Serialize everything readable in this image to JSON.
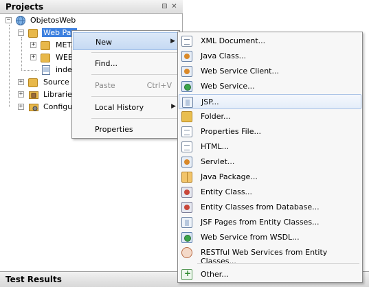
{
  "projects_panel": {
    "title": "Projects",
    "minimize_glyph": "⊟",
    "close_glyph": "✕",
    "tree": [
      {
        "label": "ObjetosWeb",
        "icon": "globe-project-icon",
        "expander": "−"
      },
      {
        "label": "Web Pages",
        "icon": "web-pages-folder-icon",
        "expander": "−",
        "selected": true
      },
      {
        "label": "META-INF",
        "icon": "folder-icon",
        "expander": "+"
      },
      {
        "label": "WEB-INF",
        "icon": "folder-icon",
        "expander": "+"
      },
      {
        "label": "index.jsp",
        "icon": "jsp-file-icon",
        "expander": ""
      },
      {
        "label": "Source Packages",
        "icon": "source-packages-icon",
        "expander": "+"
      },
      {
        "label": "Libraries",
        "icon": "libraries-icon",
        "expander": "+"
      },
      {
        "label": "Configuration Files",
        "icon": "config-files-icon",
        "expander": "+"
      }
    ],
    "visible_labels": [
      "ObjetosWeb",
      "Web Pag",
      "META",
      "WEB",
      "inde",
      "Source F",
      "Libraries",
      "Configur"
    ]
  },
  "context_menu": {
    "items": [
      {
        "label": "New",
        "has_submenu": true,
        "highlighted": true,
        "enabled": true
      },
      {
        "label": "Find...",
        "has_submenu": false,
        "enabled": true
      },
      {
        "label": "Paste",
        "accelerator": "Ctrl+V",
        "has_submenu": false,
        "enabled": false
      },
      {
        "label": "Local History",
        "has_submenu": true,
        "enabled": true
      },
      {
        "label": "Properties",
        "has_submenu": false,
        "enabled": true
      }
    ]
  },
  "submenu": {
    "items": [
      {
        "label": "XML Document...",
        "icon": "xml-document-icon"
      },
      {
        "label": "Java Class...",
        "icon": "java-class-icon"
      },
      {
        "label": "Web Service Client...",
        "icon": "web-service-client-icon"
      },
      {
        "label": "Web Service...",
        "icon": "web-service-icon"
      },
      {
        "label": "JSP...",
        "icon": "jsp-icon",
        "highlighted": true
      },
      {
        "label": "Folder...",
        "icon": "folder-icon"
      },
      {
        "label": "Properties File...",
        "icon": "properties-file-icon"
      },
      {
        "label": "HTML...",
        "icon": "html-icon"
      },
      {
        "label": "Servlet...",
        "icon": "servlet-icon"
      },
      {
        "label": "Java Package...",
        "icon": "java-package-icon"
      },
      {
        "label": "Entity Class...",
        "icon": "entity-class-icon"
      },
      {
        "label": "Entity Classes from Database...",
        "icon": "entity-classes-db-icon"
      },
      {
        "label": "JSF Pages from Entity Classes...",
        "icon": "jsf-pages-icon"
      },
      {
        "label": "Web Service from WSDL...",
        "icon": "web-service-wsdl-icon"
      },
      {
        "label": "RESTful Web Services from Entity Classes...",
        "icon": "restful-ws-icon"
      },
      {
        "label": "Other...",
        "icon": "other-icon"
      }
    ]
  },
  "bottom_panel": {
    "title": "Test Results"
  },
  "colors": {
    "selection": "#3d80df",
    "menu_background": "#f7f7f7",
    "menu_highlight": "#c6daf3"
  }
}
